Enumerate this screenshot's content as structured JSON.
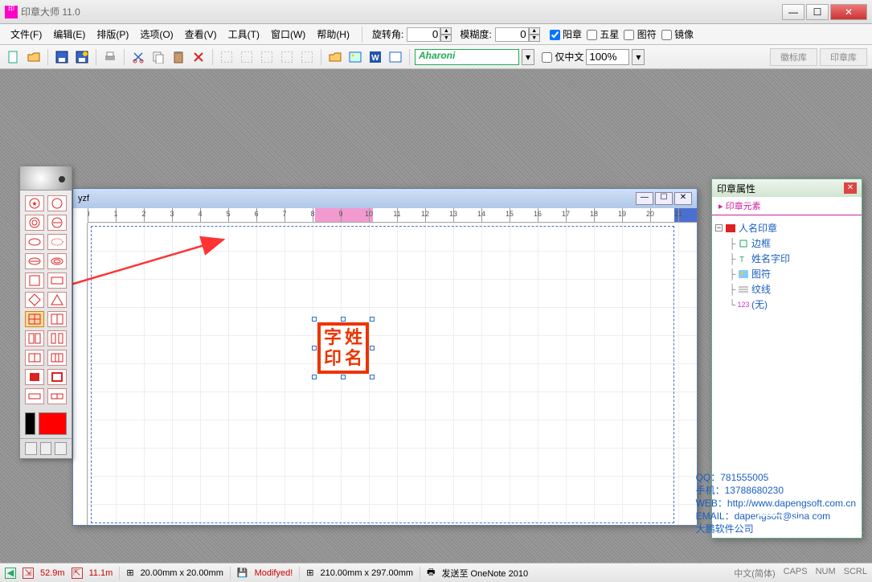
{
  "app": {
    "title": "印章大师 11.0",
    "logo": "印章\nDPS"
  },
  "menu": [
    "文件(F)",
    "编辑(E)",
    "排版(P)",
    "选项(O)",
    "查看(V)",
    "工具(T)",
    "窗口(W)",
    "帮助(H)"
  ],
  "spin": {
    "rotate_label": "旋转角:",
    "rotate_val": "0",
    "blur_label": "模糊度:",
    "blur_val": "0"
  },
  "checks": {
    "yang": "阳章",
    "star": "五星",
    "tu": "图符",
    "mirror": "镜像"
  },
  "font": {
    "name": "Aharoni",
    "only_cn": "仅中文",
    "zoom": "100%"
  },
  "lib_tabs": {
    "badge": "徽标库",
    "seal": "印章库"
  },
  "doc": {
    "title": "yzf"
  },
  "ruler": {
    "nums": [
      "0",
      "1",
      "2",
      "3",
      "4",
      "5",
      "6",
      "7",
      "8",
      "9",
      "10",
      "11",
      "12",
      "13",
      "14",
      "15",
      "16",
      "17",
      "18",
      "19",
      "20",
      "21"
    ]
  },
  "seal": {
    "c1": "字",
    "c2": "姓",
    "c3": "印",
    "c4": "名"
  },
  "prop": {
    "title": "印章属性",
    "section": "印章元素",
    "root": "人名印章",
    "children": [
      "边框",
      "姓名字印",
      "图符",
      "纹线",
      "(无)"
    ]
  },
  "contact": {
    "qq_l": "QQ：",
    "qq_v": "781555005",
    "ph_l": "手机：",
    "ph_v": "13788680230",
    "web_l": "WEB：",
    "web_v": "http://www.dapengsoft.com.cn",
    "em_l": "EMAIL：",
    "em_v": "dapengsoft@sina.com",
    "co": "大鹏软件公司",
    "sendto": "发送至 OneNote 2010"
  },
  "watermark": "系统之家",
  "status": {
    "x": "52.9m",
    "y": "11.1m",
    "obj": "20.00mm x 20.00mm",
    "mod": "Modifyed!",
    "page": "210.00mm x 297.00mm",
    "sendto": "发送至 OneNote 2010",
    "lang": "中文(简体)",
    "caps": "CAPS",
    "num": "NUM",
    "scrl": "SCRL"
  }
}
